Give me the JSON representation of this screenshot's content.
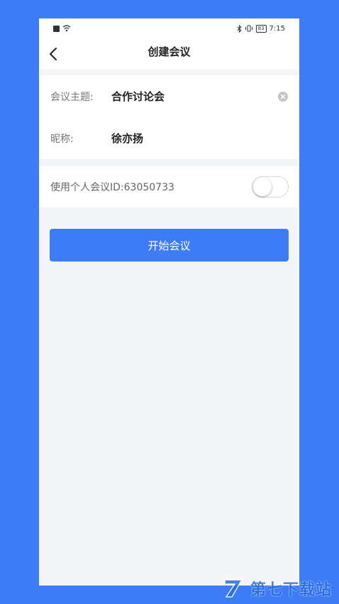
{
  "status_bar": {
    "time": "7:15",
    "battery": "83",
    "sim_icon": "sim-icon",
    "wifi_icon": "wifi-icon",
    "bluetooth_icon": "bluetooth-icon",
    "vibrate_icon": "vibrate-icon"
  },
  "nav": {
    "title": "创建会议",
    "back_icon": "chevron-left-icon"
  },
  "form": {
    "topic_label": "会议主题:",
    "topic_value": "合作讨论会",
    "nickname_label": "昵称:",
    "nickname_value": "徐亦扬"
  },
  "personal_id": {
    "label": "使用个人会议ID:63050733",
    "toggle_on": false
  },
  "start_button": {
    "label": "开始会议"
  },
  "watermark": {
    "text": "第七下载站"
  },
  "colors": {
    "accent": "#3d7cf5",
    "background": "#f4f5f7"
  }
}
